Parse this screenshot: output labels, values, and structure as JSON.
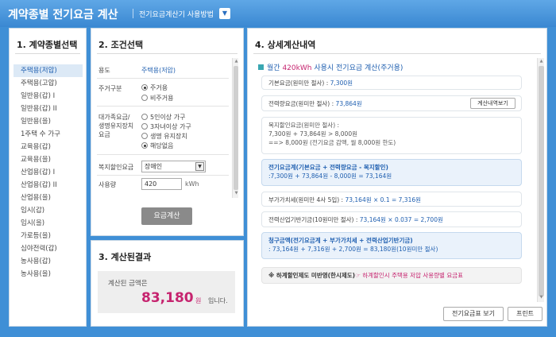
{
  "window": {
    "title": "계약종별 전기요금 계산",
    "guide_link": "전기요금계산기 사용방법",
    "dropdown_icon": "chevron-down"
  },
  "panel1": {
    "title": "1. 계약종별선택",
    "items": [
      "주택용(저압)",
      "주택용(고압)",
      "일반용(갑) I",
      "일반용(갑) II",
      "일반용(을)",
      "1주택 수 가구",
      "교육용(갑)",
      "교육용(을)",
      "산업용(갑) I",
      "산업용(갑) II",
      "산업용(을)",
      "임시(갑)",
      "임시(을)",
      "가로등(을)",
      "심야전력(갑)",
      "농사용(갑)",
      "농사용(을)"
    ],
    "selected_index": 0
  },
  "panel2": {
    "title": "2. 조건선택",
    "usage_label": "용도",
    "usage_value": "주택용(저압)",
    "housing_label": "주거구분",
    "housing_options": [
      "주거용",
      "비주거용"
    ],
    "housing_selected": 0,
    "discount_label_1": "대가족요금/",
    "discount_label_2": "생명유지장치",
    "discount_label_3": "요금",
    "discount_options": [
      "5인이상 가구",
      "3자녀이상 가구",
      "생명 유지장치",
      "해당없음"
    ],
    "discount_selected": 3,
    "welfare_label": "복지할인요금",
    "welfare_value": "장애인",
    "usage_amount_label": "사용량",
    "usage_amount_value": "420",
    "usage_unit": "kWh",
    "calc_button": "요금계산"
  },
  "panel3": {
    "title": "3. 계산된결과",
    "label": "계산된 금액은",
    "amount": "83,180",
    "won": "원",
    "tail": "입니다."
  },
  "panel4": {
    "title": "4. 상세계산내역",
    "head_prefix": "월간",
    "head_kwh": "420kWh",
    "head_suffix": "사용시 전기요금 계산(주거용)",
    "basic_label": "기본요금(원미만 절사) :",
    "basic_value": "7,300원",
    "energy_label": "전력량요금(원미만 절사) :",
    "energy_value": "73,864원",
    "detail_button": "계산내역보기",
    "welfare_line1": "복지할인요금(원미만 절사) :",
    "welfare_line2": "7,300원  +  73,864원  >  8,000원",
    "welfare_line3": "==> 8,000원 (전기요금 감액, 월 8,000원 한도)",
    "sum_line1": "전기요금계(기본요금 + 전력량요금 - 복지할인)",
    "sum_line2": ":7,300원  +  73,864원  -  8,000원  =  73,164원",
    "vat_label": "부가가치세(원미만 4사 5입) :",
    "vat_value": "73,164원  ×  0.1  =  7,316원",
    "fund_label": "전력산업기반기금(10원미만 절사) :",
    "fund_value": "73,164원  ×  0.037  =  2,700원",
    "claim_line1": "청구금액(전기요금계 + 부가가치세 + 전력산업기반기금)",
    "claim_line2": ": 73,164원  +  7,316원  +  2,700원  =  83,180원(10원미만 절사)",
    "note_prefix": "※ 하계할인제도 미반영(한시제도)",
    "note_mark": "☞",
    "note_suffix": "하계할인시 주택용 저압 사용량별 요금표",
    "print_table_button": "전기요금표 보기",
    "print_button": "프린트"
  }
}
